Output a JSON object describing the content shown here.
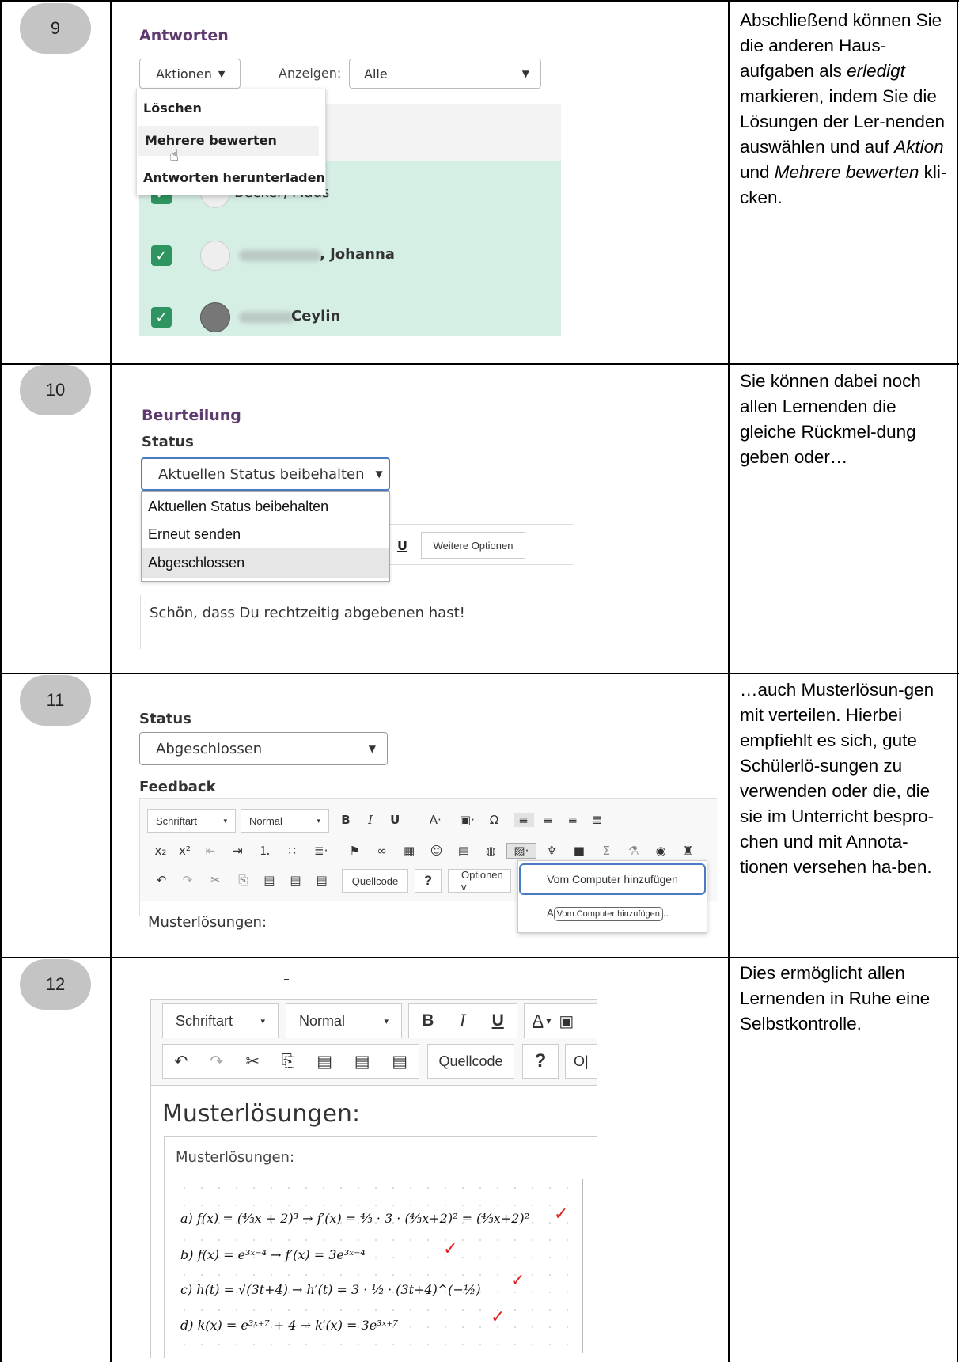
{
  "rows": [
    {
      "number": "9"
    },
    {
      "number": "10"
    },
    {
      "number": "11"
    },
    {
      "number": "12"
    }
  ],
  "step9": {
    "heading": "Antworten",
    "actions_button": "Aktionen",
    "show_label": "Anzeigen:",
    "show_value": "Alle",
    "menu": [
      "Löschen",
      "Mehrere bewerten",
      "Antworten herunterladen"
    ],
    "students": [
      {
        "name": "Becker, Mads"
      },
      {
        "name": ", Johanna"
      },
      {
        "name": " Ceylin"
      }
    ]
  },
  "desc9": {
    "p1": "Abschließend können Sie die anderen Haus-aufgaben als ",
    "em1": "erledigt",
    "p2": " markieren, indem Sie die Lösungen der Ler-nenden auswählen und auf ",
    "em2": "Aktion",
    "p3": " und ",
    "em3": "Mehrere bewerten",
    "p4": " kli-cken."
  },
  "step10": {
    "heading": "Beurteilung",
    "status_label": "Status",
    "status_value": "Aktuellen Status beibehalten",
    "options": [
      "Aktuellen Status beibehalten",
      "Erneut senden",
      "Abgeschlossen"
    ],
    "underline_btn": "U",
    "more_options": "Weitere Optionen",
    "editor_text": "Schön, dass Du rechtzeitig abgebenen hast!"
  },
  "desc10": "Sie können dabei noch allen Lernenden die gleiche Rückmel-dung geben oder…",
  "step11": {
    "status_label": "Status",
    "status_value": "Abgeschlossen",
    "feedback_label": "Feedback",
    "font_select": "Schriftart",
    "size_select": "Normal",
    "source_btn": "Quellcode",
    "help_btn": "?",
    "options_btn": "Optionen v",
    "image_menu_item": "Vom Computer hinzufügen",
    "tooltip_prefix": "A",
    "tooltip": "Vom Computer hinzufügen",
    "tooltip_suffix": "..",
    "editor_text": "Musterlösungen:"
  },
  "desc11": "…auch Musterlösun-gen mit verteilen. Hierbei empfiehlt es sich, gute Schülerlö-sungen zu verwenden oder die, die sie im Unterricht bespro-chen und mit Annota-tionen versehen ha-ben.",
  "step12": {
    "font_select": "Schriftart",
    "size_select": "Normal",
    "source_btn": "Quellcode",
    "help_btn": "?",
    "cut_off_btn": "O|",
    "heading": "Musterlösungen:",
    "inner_label": "Musterlösungen:",
    "solutions": [
      "a) f(x) = (⁴⁄₃x + 2)³  → f′(x) = ⁴⁄₃ · 3 · (⁴⁄₃x+2)² = (⁴⁄₃x+2)²",
      "b) f(x) = e³ˣ⁻⁴  → f′(x) = 3e³ˣ⁻⁴",
      "c) h(t) = √(3t+4)  → h′(t) = 3 · ¹⁄₂ · (3t+4)^(−½)",
      "d) k(x) = e³ˣ⁺⁷ + 4  → k′(x) = 3e³ˣ⁺⁷"
    ]
  },
  "desc12": "Dies ermöglicht allen Lernenden in Ruhe eine Selbstkontrolle.",
  "colors": {
    "purple": "#5e3a6e",
    "green_row": "#d6efe5",
    "check": "#2e9460",
    "correction": "#e02020"
  }
}
